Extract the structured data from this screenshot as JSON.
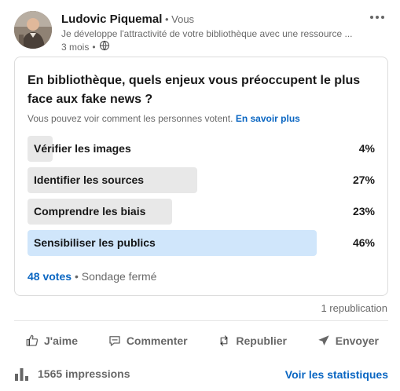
{
  "post": {
    "author_name": "Ludovic Piquemal",
    "author_separator": " • ",
    "author_relation": "Vous",
    "headline": "Je développe l'attractivité de votre bibliothèque avec une ressource ...",
    "time": "3 mois",
    "time_separator": "•",
    "visibility_icon": "globe-icon",
    "more_icon": "more-options-icon"
  },
  "poll": {
    "question": "En bibliothèque, quels enjeux vous préoccupent le plus face aux fake news ?",
    "note": "Vous pouvez voir comment les personnes votent.",
    "note_link": "En savoir plus",
    "options": [
      {
        "label": "Vérifier les images",
        "percent_label": "4%",
        "percent": 4,
        "selected": false
      },
      {
        "label": "Identifier les sources",
        "percent_label": "27%",
        "percent": 27,
        "selected": false
      },
      {
        "label": "Comprendre les biais",
        "percent_label": "23%",
        "percent": 23,
        "selected": false
      },
      {
        "label": "Sensibiliser les publics",
        "percent_label": "46%",
        "percent": 46,
        "selected": true
      }
    ],
    "votes": "48 votes",
    "footer_separator": "•",
    "status": "Sondage fermé"
  },
  "social": {
    "reposts": "1 republication"
  },
  "actions": {
    "like": "J'aime",
    "comment": "Commenter",
    "repost": "Republier",
    "send": "Envoyer"
  },
  "stats": {
    "impressions": "1565 impressions",
    "see_stats": "Voir les statistiques"
  },
  "colors": {
    "link": "#0a66c2",
    "bar": "#e8e8e8",
    "bar_selected": "#d0e6fb"
  }
}
